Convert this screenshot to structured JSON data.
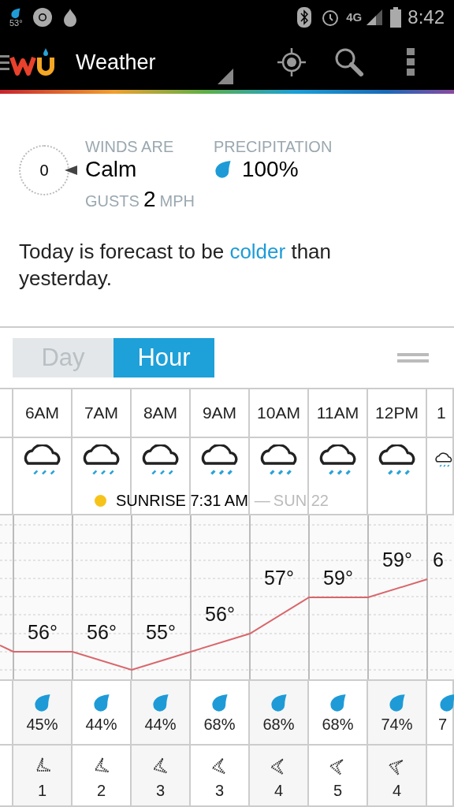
{
  "status_bar": {
    "temp": "53°",
    "time": "8:42",
    "network": "4G"
  },
  "app_bar": {
    "title": "Weather"
  },
  "wind": {
    "speed": "0",
    "label": "WINDS ARE",
    "value": "Calm",
    "gusts_label": "GUSTS",
    "gusts_value": "2",
    "gusts_unit": "MPH"
  },
  "precipitation": {
    "label": "PRECIPITATION",
    "value": "100%"
  },
  "forecast_note": {
    "before": "Today is forecast to be ",
    "highlight": "colder",
    "after": " than yesterday."
  },
  "tabs": [
    {
      "label": "Day",
      "selected": false
    },
    {
      "label": "Hour",
      "selected": true
    }
  ],
  "sunrise": {
    "label": "SUNRISE 7:31 AM",
    "dash": "—",
    "date": "SUN 22"
  },
  "hours": [
    {
      "time": "6AM",
      "temp": "56°",
      "precip": "45%",
      "wind": "1"
    },
    {
      "time": "7AM",
      "temp": "56°",
      "precip": "44%",
      "wind": "2"
    },
    {
      "time": "8AM",
      "temp": "55°",
      "precip": "44%",
      "wind": "3"
    },
    {
      "time": "9AM",
      "temp": "56°",
      "precip": "68%",
      "wind": "3"
    },
    {
      "time": "10AM",
      "temp": "57°",
      "precip": "68%",
      "wind": "4"
    },
    {
      "time": "11AM",
      "temp": "59°",
      "precip": "68%",
      "wind": "5"
    },
    {
      "time": "12PM",
      "temp": "59°",
      "precip": "74%",
      "wind": "4"
    },
    {
      "time": "1",
      "temp": "6",
      "precip": "7"
    }
  ]
}
